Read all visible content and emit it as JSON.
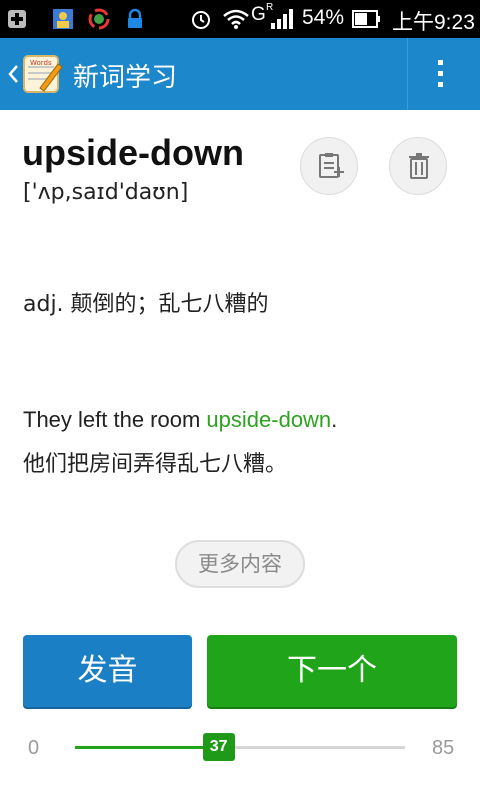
{
  "status_bar": {
    "battery_percent": "54%",
    "time": "上午9:23",
    "network_label": "G",
    "roaming_label": "R",
    "icons": [
      "add-box-icon",
      "contacts-icon",
      "sync-icon",
      "lock-icon",
      "alarm-icon",
      "wifi-icon",
      "signal-icon",
      "battery-icon"
    ]
  },
  "action_bar": {
    "title": "新词学习",
    "logo_text": "Words",
    "colors": {
      "background": "#1d87cc"
    }
  },
  "word": {
    "headword": "upside-down",
    "phonetic": "['ʌp,saɪd'daʊn]"
  },
  "definition": "adj. 颠倒的；乱七八糟的",
  "example": {
    "before": "They left the room ",
    "highlight": "upside-down",
    "after": ".",
    "translation": "他们把房间弄得乱七八糟。",
    "highlight_color": "#2ea31f"
  },
  "buttons": {
    "more_label": "更多内容",
    "pronounce_label": "发音",
    "next_label": "下一个"
  },
  "progress": {
    "min": "0",
    "max": "85",
    "current": "37",
    "current_value": 37,
    "max_value": 85
  }
}
